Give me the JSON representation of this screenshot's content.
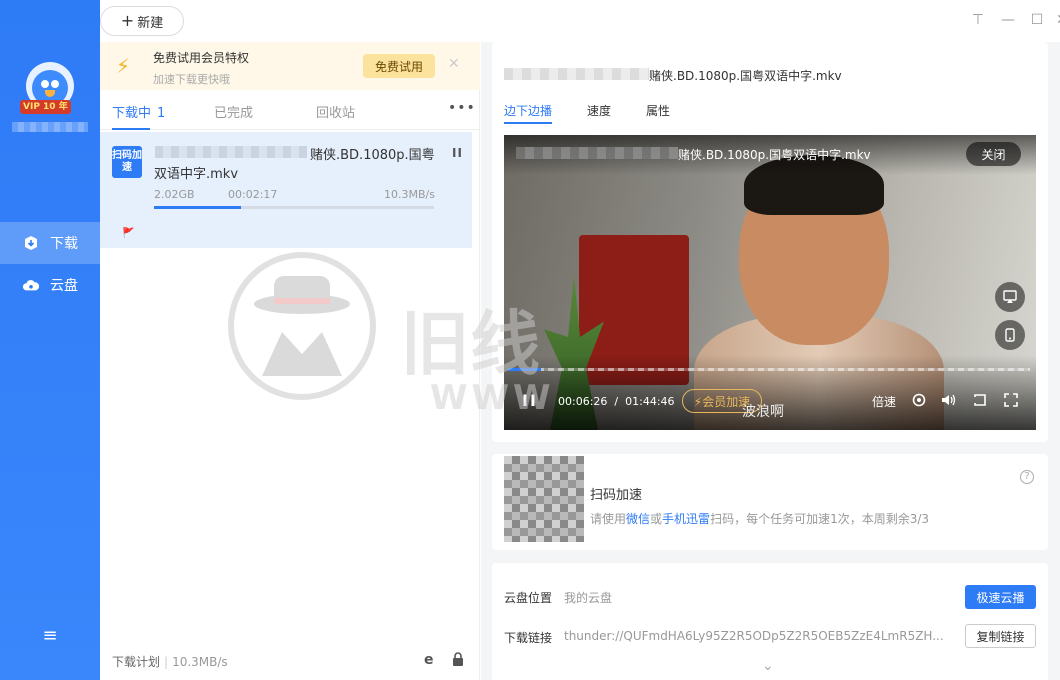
{
  "sidebar": {
    "vip_badge": "VIP 10 年",
    "nav": [
      {
        "label": "下载",
        "icon": "download-icon",
        "active": true
      },
      {
        "label": "云盘",
        "icon": "cloud-icon",
        "active": false
      }
    ],
    "menu_icon": "≡"
  },
  "topbar": {
    "new_label": "新建",
    "new_plus": "+",
    "controls": {
      "pin": "⊤",
      "minimize": "—",
      "maximize": "☐",
      "close": "✕"
    }
  },
  "promo": {
    "title": "免费试用会员特权",
    "subtitle": "加速下载更快哦",
    "button": "免费试用",
    "close": "✕"
  },
  "tabs": {
    "downloading": "下载中",
    "downloading_count": "1",
    "completed": "已完成",
    "recycle": "回收站",
    "more": "•••"
  },
  "task": {
    "icon_text": "扫码加速",
    "name_line1": "赌侠.BD.1080p.国粤",
    "name_line2": "双语中字.mkv",
    "pause": "II",
    "size": "2.02GB",
    "elapsed": "00:02:17",
    "speed": "10.3MB/s",
    "progress": 0.31,
    "flag": "🚩"
  },
  "footer": {
    "plan_label": "下载计划",
    "speed": "10.3MB/s"
  },
  "watermark": {
    "text": "旧线",
    "www": "WWW"
  },
  "details": {
    "file_name": "赌侠.BD.1080p.国粤双语中字.mkv",
    "tabs": [
      "边下边播",
      "速度",
      "属性"
    ],
    "player": {
      "title": "赌侠.BD.1080p.国粤双语中字.mkv",
      "close": "关闭",
      "current_time": "00:06:26",
      "time_sep": "/",
      "total_time": "01:44:46",
      "vip_accel": "⚡会员加速",
      "subtitle": "波浪啊",
      "speed_label": "倍速",
      "progress": 0.063
    }
  },
  "scan": {
    "title": "扫码加速",
    "desc_pre": "请使用",
    "wechat": "微信",
    "or": "或",
    "app": "手机迅雷",
    "desc_post": "扫码，每个任务可加速1次，本周剩余3/3",
    "help": "?"
  },
  "cloud": {
    "location_label": "云盘位置",
    "location_value": "我的云盘",
    "fast_button": "极速云播",
    "link_label": "下载链接",
    "link_value": "thunder://QUFmdHA6Ly95Z2R5ODp5Z2R5OEB5ZzE4LmR5ZH...",
    "copy_button": "复制链接",
    "chevron": "⌄"
  }
}
